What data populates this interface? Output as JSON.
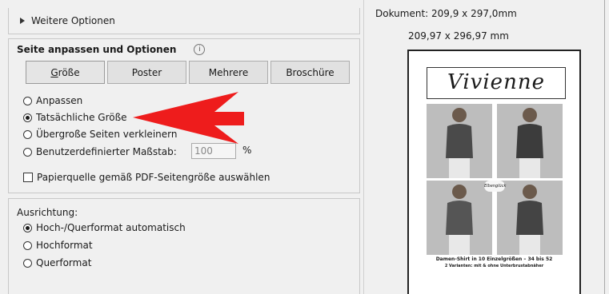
{
  "left_panel": {
    "more_options": "Weitere Optionen",
    "section_title": "Seite anpassen und Optionen",
    "info_icon_char": "i",
    "buttons": [
      {
        "label": "Größe",
        "accel": "G",
        "rest": "röße"
      },
      {
        "label": "Poster"
      },
      {
        "label": "Mehrere"
      },
      {
        "label": "Broschüre"
      }
    ],
    "sizing": {
      "fit": "Anpassen",
      "actual": "Tatsächliche Größe",
      "shrink": "Übergroße Seiten verkleinern",
      "custom": "Benutzerdefinierter Maßstab:",
      "custom_value": "100",
      "custom_unit": "%",
      "selected": "actual"
    },
    "paper_source": "Papierquelle gemäß PDF-Seitengröße auswählen",
    "orientation": {
      "label": "Ausrichtung:",
      "auto": "Hoch-/Querformat automatisch",
      "portrait": "Hochformat",
      "landscape": "Querformat",
      "selected": "auto"
    },
    "annotation_arrow_color": "#ee1c1c"
  },
  "preview": {
    "document_size": "Dokument: 209,9 x 297,0mm",
    "paper_size": "209,97 x 296,97 mm",
    "page_title": "Vivienne",
    "logo_text": "Elbenglück",
    "caption_line1": "Damen-Shirt in 10 Einzelgrößen – 34 bis 52",
    "caption_line2": "2 Varianten: mit & ohne Unterbrustabnäher"
  }
}
